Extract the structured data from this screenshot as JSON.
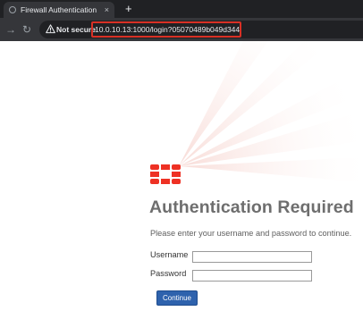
{
  "browser": {
    "tab_title": "Firewall Authentication",
    "tab_close": "×",
    "new_tab": "+",
    "security_label": "Not secure",
    "url": "10.0.10.13:1000/login?05070489b049d344",
    "back_glyph": "←",
    "forward_glyph": "→",
    "reload_glyph": "↻",
    "url_highlight_color": "#d93025"
  },
  "page": {
    "logo_icon": "fortinet-logo-icon",
    "logo_color": "#ee3124",
    "title": "Authentication Required",
    "description": "Please enter your username and password to continue.",
    "username_label": "Username",
    "username_value": "",
    "password_label": "Password",
    "password_value": "",
    "submit_label": "Continue",
    "submit_color": "#2e62ad"
  }
}
